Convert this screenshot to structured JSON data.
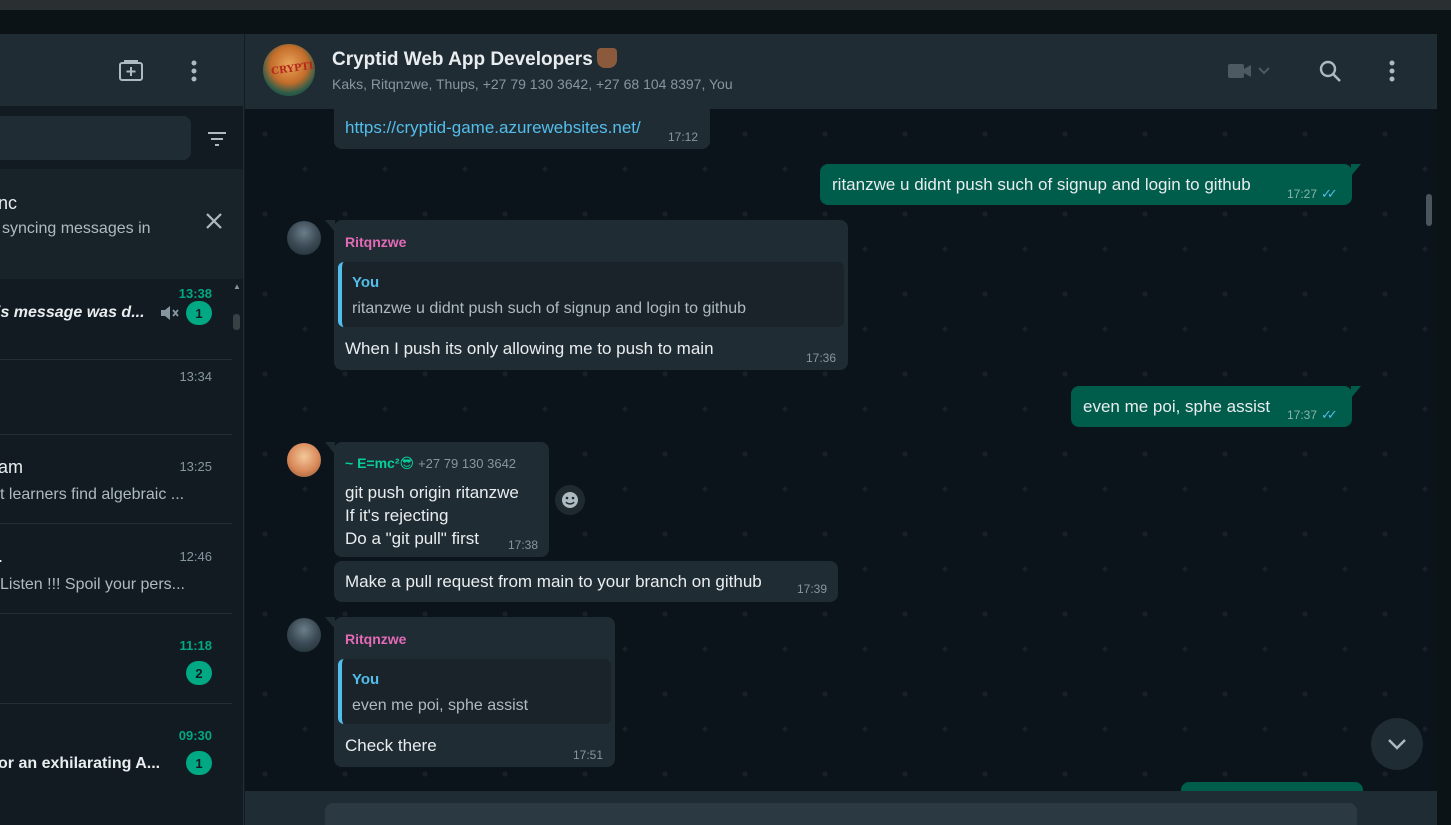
{
  "sidebar": {
    "sync": {
      "title": "nc",
      "text": "syncing messages in"
    },
    "chats": [
      {
        "name": "",
        "message": "is message was d...",
        "time": "13:38",
        "unread": "1",
        "muted": true,
        "highlight": true
      },
      {
        "name": "",
        "message": "",
        "time": "13:34",
        "unread": "",
        "muted": false,
        "highlight": false
      },
      {
        "name": "am",
        "message": "t learners find algebraic ...",
        "time": "13:25",
        "unread": "",
        "muted": false,
        "highlight": false
      },
      {
        "name": ".",
        "message": "Listen !!! Spoil your pers...",
        "time": "12:46",
        "unread": "",
        "muted": false,
        "highlight": false
      },
      {
        "name": "",
        "message": "",
        "time": "11:18",
        "unread": "2",
        "muted": false,
        "highlight": false
      },
      {
        "name": "",
        "message": "or an exhilarating A...",
        "time": "09:30",
        "unread": "1",
        "muted": false,
        "highlight": true
      }
    ]
  },
  "header": {
    "avatar_text": "CRYPTID",
    "title": "Cryptid Web App Developers",
    "members": "Kaks, Ritqnzwe, Thups, +27 79 130 3642, +27 68 104 8397, You"
  },
  "messages": [
    {
      "id": "m1",
      "direction": "in",
      "text": "https://cryptid-game.azurewebsites.net/",
      "time": "17:12"
    },
    {
      "id": "m2",
      "direction": "out",
      "text": "ritanzwe u didnt push such of signup and login to github",
      "time": "17:27"
    },
    {
      "id": "m3",
      "direction": "in",
      "sender": "Ritqnzwe",
      "sender_color": "#e26ab6",
      "quote_name": "You",
      "quote_text": "ritanzwe u didnt push such of signup and login to github",
      "text": "When I push its only allowing me to push to main",
      "time": "17:36"
    },
    {
      "id": "m4",
      "direction": "out",
      "text": "even me poi,  sphe assist",
      "time": "17:37"
    },
    {
      "id": "m5",
      "direction": "in",
      "sender": "~ E=mc²😎",
      "sender_color": "#06cf9c",
      "sender_phone": "+27 79 130 3642",
      "lines": [
        "git push origin ritanzwe",
        "If it's rejecting",
        "Do a \"git pull\" first"
      ],
      "time": "17:38"
    },
    {
      "id": "m6",
      "direction": "in",
      "text": "Make a pull request from main to your branch on github",
      "time": "17:39"
    },
    {
      "id": "m7",
      "direction": "in",
      "sender": "Ritqnzwe",
      "sender_color": "#e26ab6",
      "quote_name": "You",
      "quote_text": "even me poi,  sphe assist",
      "text": "Check there",
      "time": "17:51"
    }
  ],
  "colors": {
    "accent": "#00a884",
    "outgoing_bubble": "#005c4b",
    "incoming_bubble": "#202c33",
    "read_ticks": "#53bdeb"
  }
}
